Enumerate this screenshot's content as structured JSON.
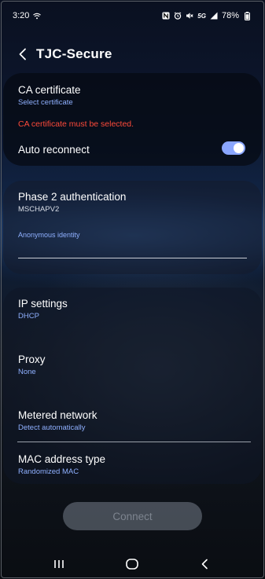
{
  "status_bar": {
    "time": "3:20",
    "network_type": "5G",
    "battery": "78%"
  },
  "header": {
    "title": "TJC-Secure"
  },
  "ca_certificate": {
    "title": "CA certificate",
    "value": "Select certificate",
    "error": "CA certificate must be selected."
  },
  "auto_reconnect": {
    "label": "Auto reconnect",
    "enabled": true
  },
  "phase2": {
    "title": "Phase 2 authentication",
    "value": "MSCHAPV2"
  },
  "anonymous_identity": {
    "label": "Anonymous identity",
    "value": ""
  },
  "ip_settings": {
    "title": "IP settings",
    "value": "DHCP"
  },
  "proxy": {
    "title": "Proxy",
    "value": "None"
  },
  "metered_network": {
    "title": "Metered network",
    "value": "Detect automatically"
  },
  "mac_address": {
    "title": "MAC address type",
    "value": "Randomized MAC"
  },
  "connect_button": {
    "label": "Connect"
  },
  "colors": {
    "accent": "#8fb0ff",
    "error": "#ff4a3a",
    "toggle_on": "#8aa6ff"
  }
}
